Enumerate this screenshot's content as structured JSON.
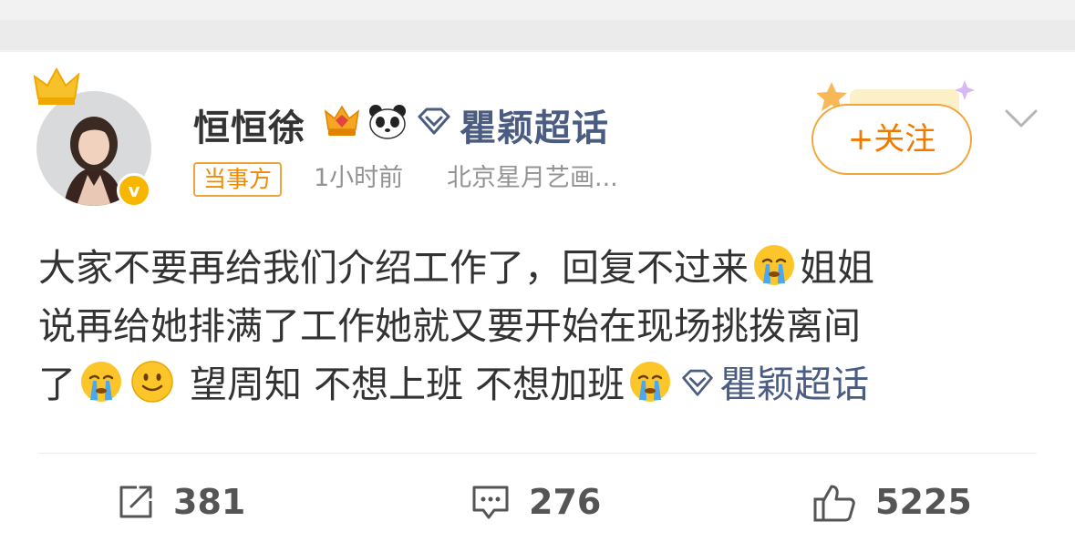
{
  "user": {
    "name": "恒恒徐",
    "verified_badge": "v",
    "role_tag": "当事方",
    "time": "1小时前",
    "source": "北京星月艺画..."
  },
  "topic_header": {
    "label": "瞿颖超话",
    "icon": "diamond-icon"
  },
  "follow_button": {
    "label": "+关注"
  },
  "post": {
    "line1_text": "大家不要再给我们介绍工作了，回复不过来",
    "line1_tail": "姐姐",
    "line2_text": "说再给她排满了工作她就又要开始在现场挑拨离间",
    "line3_start": "了",
    "line3_text": " 望周知 不想上班 不想加班",
    "topic_label": "瞿颖超话"
  },
  "actions": {
    "repost_count": "381",
    "comment_count": "276",
    "like_count": "5225"
  },
  "colors": {
    "accent_orange": "#f07a00",
    "topic_blue": "#4a5c82",
    "verified_yellow": "#f8b600"
  }
}
